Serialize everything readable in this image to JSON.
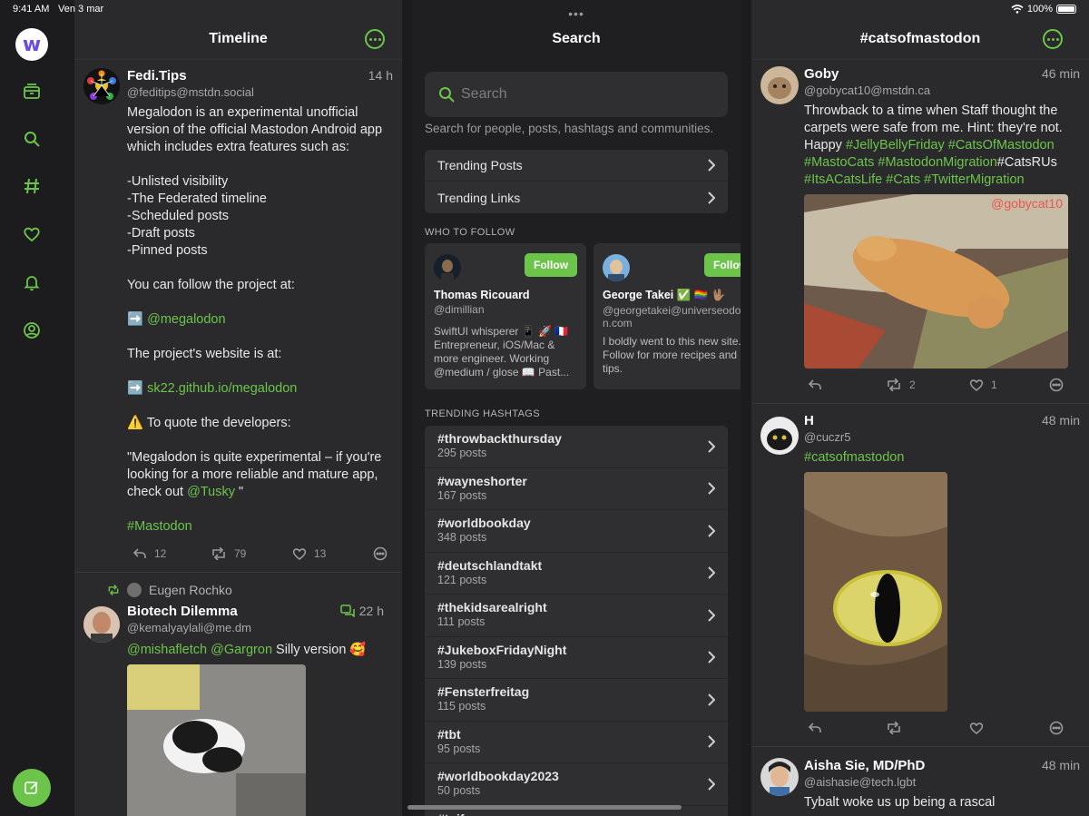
{
  "status": {
    "time": "9:41 AM",
    "date": "Ven 3 mar",
    "battery": "100%"
  },
  "rail": {
    "logo_letter": "w",
    "items": [
      "feed-icon",
      "search-icon",
      "hashtag-icon",
      "heart-icon",
      "bell-icon",
      "profile-icon"
    ],
    "compose_icon": "compose-icon"
  },
  "timeline": {
    "title": "Timeline",
    "posts": [
      {
        "name": "Fedi.Tips",
        "handle": "@feditips@mstdn.social",
        "time": "14 h",
        "body_1": "Megalodon is an experimental unofficial version of the official Mastodon Android app which includes extra features such as:\n\n-Unlisted visibility\n-The Federated timeline\n-Scheduled posts\n-Draft posts\n-Pinned posts\n\nYou can follow the project at:",
        "link_1_emoji": "➡️",
        "link_1": "@megalodon",
        "body_2": "The project's website is at:",
        "link_2_emoji": "➡️",
        "link_2": "sk22.github.io/megalodon",
        "body_3": "⚠️ To quote the developers:",
        "body_4": "\"Megalodon is quite experimental – if you're looking for a more reliable and mature app, check out ",
        "link_3": "@Tusky",
        "body_4_end": " \"",
        "hashtag": "#Mastodon",
        "replies": "12",
        "boosts": "79",
        "likes": "13"
      },
      {
        "boosted_by": "Eugen Rochko",
        "name": "Biotech Dilemma",
        "handle": "@kemalyaylali@me.dm",
        "time": "22 h",
        "mention_1": "@mishafletch",
        "mention_2": "@Gargron",
        "text": " Silly version 🥰"
      }
    ]
  },
  "search": {
    "title": "Search",
    "placeholder": "Search",
    "hint": "Search for people, posts, hashtags and communities.",
    "links": [
      "Trending Posts",
      "Trending Links"
    ],
    "who_to_follow_label": "WHO TO FOLLOW",
    "follow_cards": [
      {
        "name": "Thomas Ricouard",
        "handle": "@dimillian",
        "bio": "SwiftUI  whisperer 📱 🚀 🇫🇷 Entrepreneur, iOS/Mac & more engineer. Working @medium / glose 📖 Past...",
        "button": "Follow"
      },
      {
        "name": "George Takei ✅ 🏳️‍🌈 🖖🏽",
        "handle": "@georgetakei@universeodon.com",
        "bio": "I boldly went to this new site. Follow for more recipes and tips.",
        "button": "Follow"
      }
    ],
    "trending_label": "TRENDING HASHTAGS",
    "hashtags": [
      {
        "tag": "#throwbackthursday",
        "count": "295 posts"
      },
      {
        "tag": "#wayneshorter",
        "count": "167 posts"
      },
      {
        "tag": "#worldbookday",
        "count": "348 posts"
      },
      {
        "tag": "#deutschlandtakt",
        "count": "121 posts"
      },
      {
        "tag": "#thekidsarealright",
        "count": "111 posts"
      },
      {
        "tag": "#JukeboxFridayNight",
        "count": "139 posts"
      },
      {
        "tag": "#Fensterfreitag",
        "count": "115 posts"
      },
      {
        "tag": "#tbt",
        "count": "95 posts"
      },
      {
        "tag": "#worldbookday2023",
        "count": "50 posts"
      },
      {
        "tag": "#tuif",
        "count": ""
      }
    ]
  },
  "hashtag_col": {
    "title": "#catsofmastodon",
    "posts": [
      {
        "name": "Goby",
        "handle": "@gobycat10@mstdn.ca",
        "time": "46 min",
        "text": "Throwback to a time when Staff thought the carpets were safe from me. Hint: they're not. Happy ",
        "tags_1": "#JellyBellyFriday #CatsOfMastodon #MastoCats #MastodonMigration",
        "plain_tag": "#CatsRUs",
        "tags_2": "#ItsACatsLife #Cats #TwitterMigration",
        "image_watermark": "@gobycat10",
        "boosts": "2",
        "likes": "1"
      },
      {
        "name": "H",
        "handle": "@cuczr5",
        "time": "48 min",
        "tag": "#catsofmastodon"
      },
      {
        "name": "Aisha Sie, MD/PhD",
        "handle": "@aishasie@tech.lgbt",
        "time": "48 min",
        "text": "Tybalt woke us up being a rascal"
      }
    ]
  },
  "colors": {
    "accent": "#6cc54a",
    "background": "#1c1c1e",
    "panel": "#2a2a2c"
  }
}
